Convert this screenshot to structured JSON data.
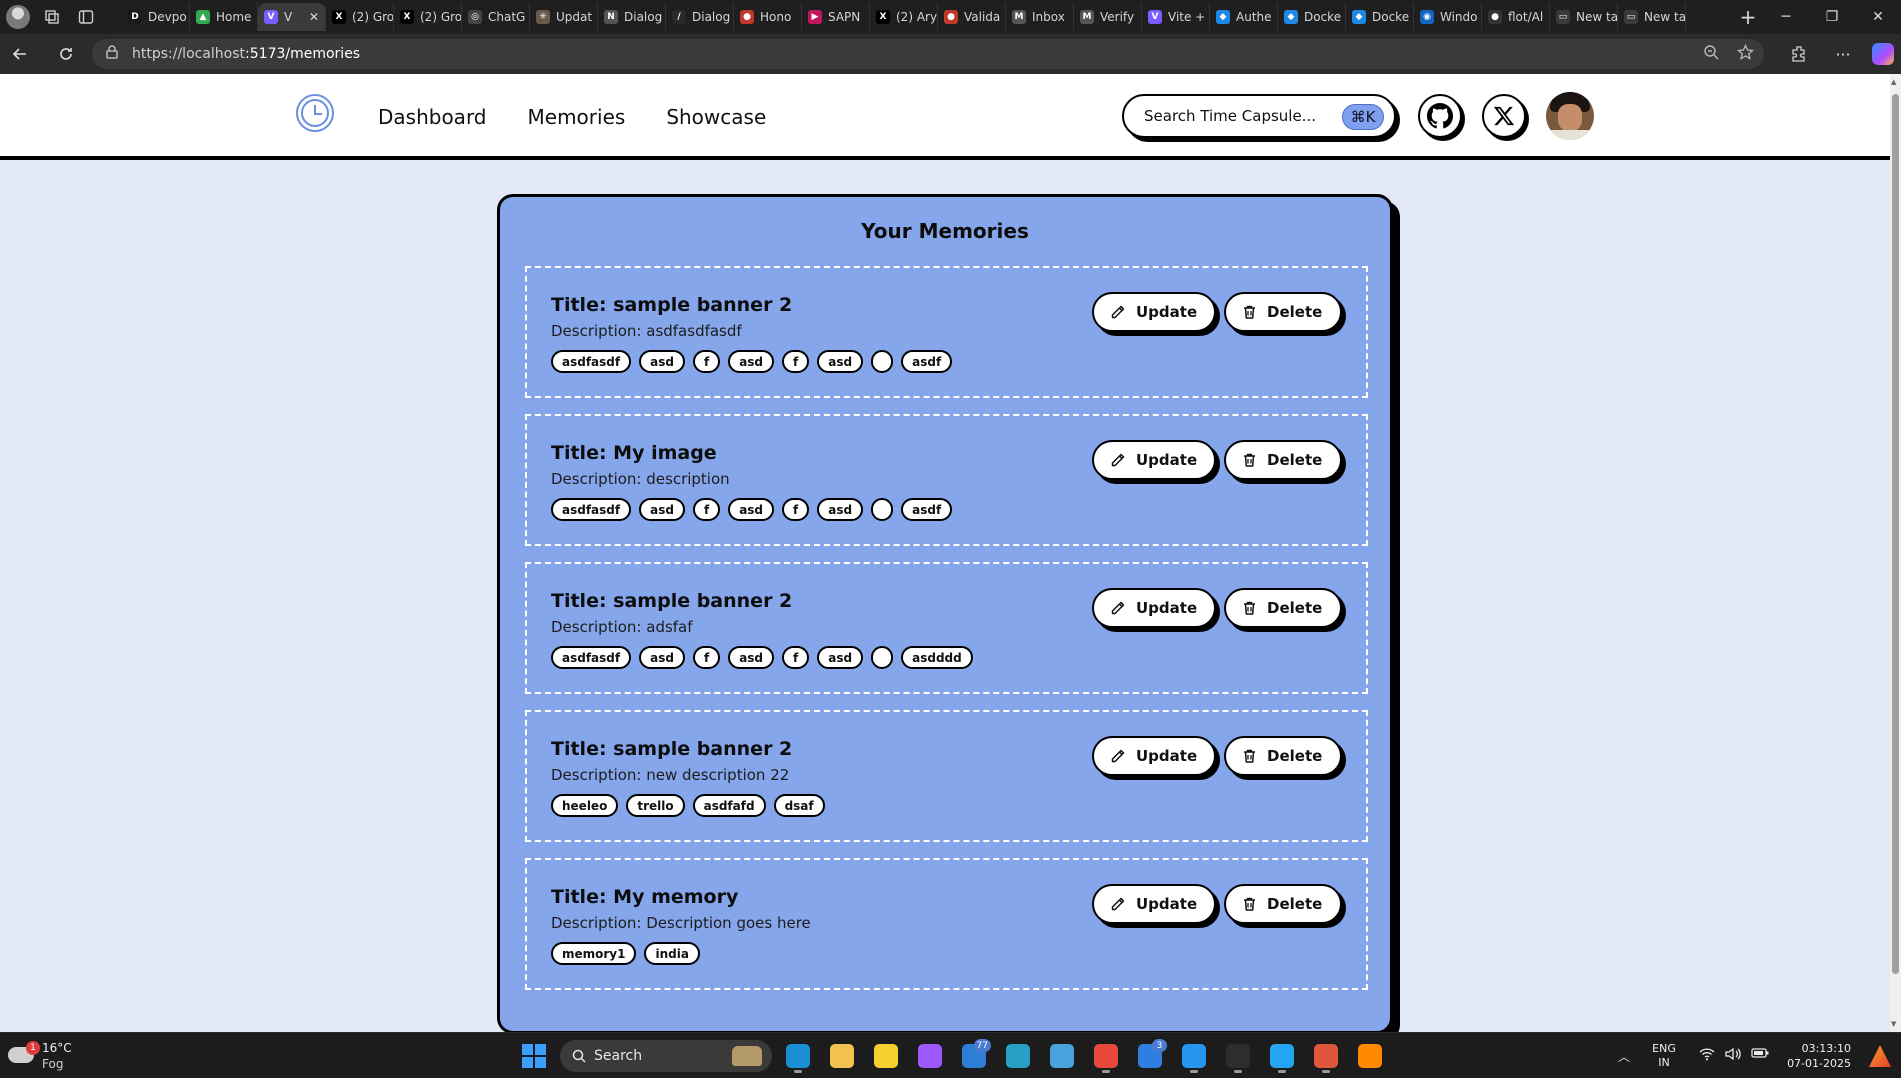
{
  "browser": {
    "tabs": [
      {
        "label": "Devpo",
        "fav_color": "#1a1a1a",
        "fav_char": "D"
      },
      {
        "label": "Home",
        "fav_color": "#34a853",
        "fav_char": "▲"
      },
      {
        "label": "V",
        "fav_color": "#7c5cff",
        "fav_char": "V",
        "active": true
      },
      {
        "label": "(2) Gro",
        "fav_color": "#000000",
        "fav_char": "X"
      },
      {
        "label": "(2) Gro",
        "fav_color": "#000000",
        "fav_char": "X"
      },
      {
        "label": "ChatG",
        "fav_color": "#444444",
        "fav_char": "◎"
      },
      {
        "label": "Updat",
        "fav_color": "#6a5a4a",
        "fav_char": "✳"
      },
      {
        "label": "Dialog",
        "fav_color": "#555555",
        "fav_char": "N"
      },
      {
        "label": "Dialog",
        "fav_color": "#2a2a2a",
        "fav_char": "/"
      },
      {
        "label": "Hono",
        "fav_color": "#c0392b",
        "fav_char": "●"
      },
      {
        "label": "SAPN",
        "fav_color": "#c2185b",
        "fav_char": "▶"
      },
      {
        "label": "(2) Ary",
        "fav_color": "#000000",
        "fav_char": "X"
      },
      {
        "label": "Valida",
        "fav_color": "#c0392b",
        "fav_char": "●"
      },
      {
        "label": "Inbox",
        "fav_color": "#555555",
        "fav_char": "M"
      },
      {
        "label": "Verify",
        "fav_color": "#555555",
        "fav_char": "M"
      },
      {
        "label": "Vite +",
        "fav_color": "#7c5cff",
        "fav_char": "V"
      },
      {
        "label": "Authe",
        "fav_color": "#1e88e5",
        "fav_char": "◆"
      },
      {
        "label": "Docke",
        "fav_color": "#1e88e5",
        "fav_char": "◆"
      },
      {
        "label": "Docke",
        "fav_color": "#1e88e5",
        "fav_char": "◆"
      },
      {
        "label": "Windo",
        "fav_color": "#1565c0",
        "fav_char": "◉"
      },
      {
        "label": "flot/Al",
        "fav_color": "#333333",
        "fav_char": "●"
      },
      {
        "label": "New ta",
        "fav_color": "#3a3a3a",
        "fav_char": "▭"
      },
      {
        "label": "New ta",
        "fav_color": "#3a3a3a",
        "fav_char": "▭"
      }
    ],
    "close_glyph": "✕",
    "new_tab_glyph": "+",
    "url_host": "https://localhost",
    "url_rest": ":5173/memories"
  },
  "nav": {
    "links": [
      "Dashboard",
      "Memories",
      "Showcase"
    ],
    "search_placeholder": "Search Time Capsule...",
    "shortcut": "⌘K"
  },
  "memories": {
    "heading": "Your Memories",
    "update_label": "Update",
    "delete_label": "Delete",
    "items": [
      {
        "title": "Title: sample banner 2",
        "description": "Description: asdfasdfasdf",
        "tags": [
          "asdfasdf",
          "asd",
          "f",
          "asd",
          "f",
          "asd",
          "",
          "asdf"
        ]
      },
      {
        "title": "Title: My image",
        "description": "Description: description",
        "tags": [
          "asdfasdf",
          "asd",
          "f",
          "asd",
          "f",
          "asd",
          "",
          "asdf"
        ]
      },
      {
        "title": "Title: sample banner 2",
        "description": "Description: adsfaf",
        "tags": [
          "asdfasdf",
          "asd",
          "f",
          "asd",
          "f",
          "asd",
          "",
          "asdddd"
        ]
      },
      {
        "title": "Title: sample banner 2",
        "description": "Description: new description 22",
        "tags": [
          "heeleo",
          "trello",
          "asdfafd",
          "dsaf"
        ]
      },
      {
        "title": "Title: My memory",
        "description": "Description: Description goes here",
        "tags": [
          "memory1",
          "india"
        ]
      }
    ]
  },
  "taskbar": {
    "weather_temp": "16°C",
    "weather_condition": "Fog",
    "weather_badge": "1",
    "search_label": "Search",
    "apps": [
      {
        "name": "edge-app",
        "color": "#1a8fd6",
        "indicator": true
      },
      {
        "name": "file-explorer-app",
        "color": "#f2c14e"
      },
      {
        "name": "sticky-notes-app",
        "color": "#f5d130"
      },
      {
        "name": "copilot-app",
        "color": "#9b59ff"
      },
      {
        "name": "teams-app",
        "color": "#2e7dd6",
        "count": "77"
      },
      {
        "name": "edge-dev-app",
        "color": "#2aa0c8"
      },
      {
        "name": "notepad-app",
        "color": "#4aa3df"
      },
      {
        "name": "chrome-app",
        "color": "#e7493b",
        "indicator": true
      },
      {
        "name": "mail-app",
        "color": "#2f7fe0",
        "count": "3"
      },
      {
        "name": "docker-app",
        "color": "#2496ed",
        "indicator": true
      },
      {
        "name": "terminal-app",
        "color": "#2d2d2d",
        "indicator": true
      },
      {
        "name": "vscode-app",
        "color": "#23a6f0",
        "indicator": true
      },
      {
        "name": "snipping-app",
        "color": "#e2553d",
        "indicator": true
      },
      {
        "name": "vlc-app",
        "color": "#ff8800"
      }
    ],
    "lang_line1": "ENG",
    "lang_line2": "IN",
    "time": "03:13:10",
    "date": "07-01-2025"
  }
}
